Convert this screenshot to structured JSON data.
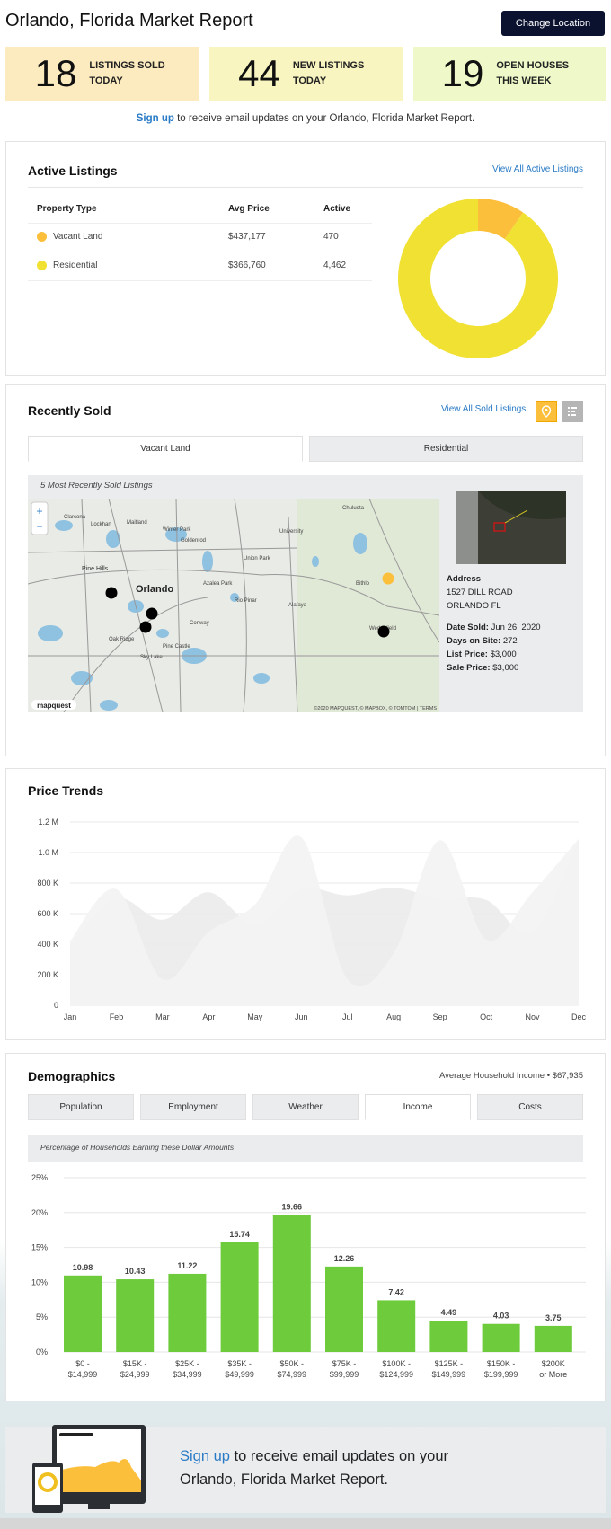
{
  "header": {
    "title": "Orlando, Florida Market Report",
    "change_location": "Change Location"
  },
  "stats": [
    {
      "value": "18",
      "label_1": "LISTINGS SOLD",
      "label_2": "TODAY",
      "color": "#fcebbf"
    },
    {
      "value": "44",
      "label_1": "NEW LISTINGS",
      "label_2": "TODAY",
      "color": "#f9f5c0"
    },
    {
      "value": "19",
      "label_1": "OPEN HOUSES",
      "label_2": "THIS WEEK",
      "color": "#eef8c8"
    }
  ],
  "signup": {
    "link": "Sign up",
    "text": " to receive email updates on your Orlando, Florida Market Report.",
    "footer_text_1": " to receive email updates on your",
    "footer_text_2": "Orlando, Florida Market Report."
  },
  "active_listings": {
    "title": "Active Listings",
    "view_all": "View All Active Listings",
    "columns": [
      "Property Type",
      "Avg Price",
      "Active"
    ],
    "rows": [
      {
        "type": "Vacant Land",
        "avg_price": "$437,177",
        "active": "470",
        "color": "#fbbf3c"
      },
      {
        "type": "Residential",
        "avg_price": "$366,760",
        "active": "4,462",
        "color": "#f0e132"
      }
    ]
  },
  "recently_sold": {
    "title": "Recently Sold",
    "view_all": "View All Sold Listings",
    "view_icons": [
      "map-pin-icon",
      "list-icon"
    ],
    "tabs": [
      "Vacant Land",
      "Residential"
    ],
    "active_tab": 0,
    "caption": "5 Most Recently Sold Listings",
    "map": {
      "city_labels": [
        "Orlando",
        "Pine Hills",
        "Winter Park",
        "University",
        "Union Park",
        "Azalea Park",
        "Alafaya",
        "Rio Pinar",
        "Oak Ridge",
        "Pine Castle",
        "Sky Lake",
        "Conway",
        "Maitland",
        "Goldenrod",
        "Bithlo",
        "Wedgefield",
        "Chuluota",
        "Clarcona",
        "Lockhart"
      ],
      "attribution": "©2020 MAPQUEST, © MAPBOX, © TOMTOM | TERMS",
      "logo": "mapquest",
      "zoom_in": "+",
      "zoom_out": "−"
    },
    "listing": {
      "address_label": "Address",
      "address_1": "1527 DILL ROAD",
      "address_2": "ORLANDO FL",
      "date_sold_label": "Date Sold:",
      "date_sold": " Jun 26, 2020",
      "days_label": "Days on Site:",
      "days": " 272",
      "list_label": "List Price:",
      "list_price": " $3,000",
      "sale_label": "Sale Price:",
      "sale_price": " $3,000"
    }
  },
  "price_trends": {
    "title": "Price Trends"
  },
  "demographics": {
    "title": "Demographics",
    "avg_income": "Average Household Income • $67,935",
    "tabs": [
      "Population",
      "Employment",
      "Weather",
      "Income",
      "Costs"
    ],
    "active_tab": 3,
    "caption": "Percentage of Households Earning these Dollar Amounts"
  },
  "chart_data": [
    {
      "type": "pie",
      "chart": "active-listings-donut",
      "categories": [
        "Vacant Land",
        "Residential"
      ],
      "values": [
        470,
        4462
      ],
      "colors": [
        "#fbbf3c",
        "#f0e132"
      ]
    },
    {
      "type": "area",
      "chart": "price-trends",
      "categories": [
        "Jan",
        "Feb",
        "Mar",
        "Apr",
        "May",
        "Jun",
        "Jul",
        "Aug",
        "Sep",
        "Oct",
        "Nov",
        "Dec"
      ],
      "yticks": [
        "0",
        "200 K",
        "400 K",
        "600 K",
        "800 K",
        "1.0 M",
        "1.2 M"
      ],
      "ylim": [
        0,
        1200000
      ],
      "grid": true,
      "series": [
        {
          "values": [
            400000,
            700000,
            560000,
            740000,
            530000,
            760000,
            720000,
            770000,
            700000,
            690000,
            480000,
            1090000
          ],
          "color": "#ececec"
        },
        {
          "values": [
            420000,
            760000,
            170000,
            480000,
            660000,
            1100000,
            170000,
            340000,
            1080000,
            430000,
            740000,
            1090000
          ],
          "color": "#f4f3f3"
        }
      ]
    },
    {
      "type": "bar",
      "chart": "income-distribution",
      "categories": [
        [
          "$0 -",
          "$14,999"
        ],
        [
          "$15K -",
          "$24,999"
        ],
        [
          "$25K -",
          "$34,999"
        ],
        [
          "$35K -",
          "$49,999"
        ],
        [
          "$50K -",
          "$74,999"
        ],
        [
          "$75K -",
          "$99,999"
        ],
        [
          "$100K -",
          "$124,999"
        ],
        [
          "$125K -",
          "$149,999"
        ],
        [
          "$150K -",
          "$199,999"
        ],
        [
          "$200K",
          "or More"
        ]
      ],
      "values": [
        10.98,
        10.43,
        11.22,
        15.74,
        19.66,
        12.26,
        7.42,
        4.49,
        4.03,
        3.75
      ],
      "labels": [
        "10.98",
        "10.43",
        "11.22",
        "15.74",
        "19.66",
        "12.26",
        "7.42",
        "4.49",
        "4.03",
        "3.75"
      ],
      "yticks": [
        "0%",
        "5%",
        "10%",
        "15%",
        "20%",
        "25%"
      ],
      "ylim": [
        0,
        25
      ],
      "grid": true,
      "color": "#6ecb3c"
    }
  ]
}
